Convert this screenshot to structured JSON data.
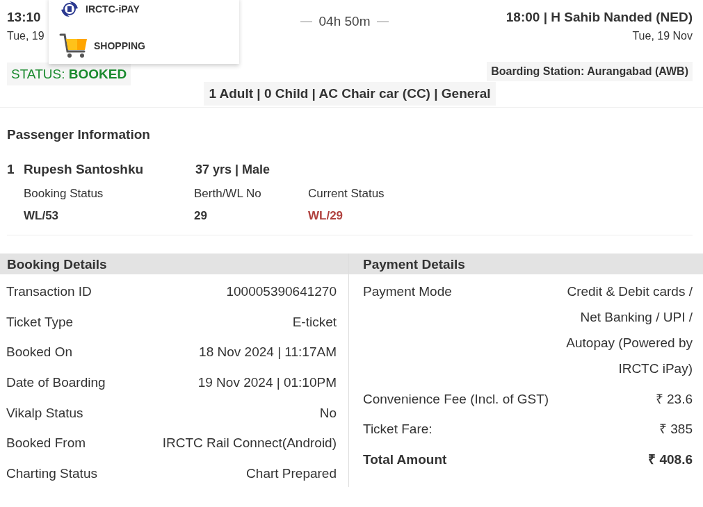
{
  "journey": {
    "departure": {
      "time": "13:10",
      "date": "Tue, 19"
    },
    "duration": "04h 50m",
    "arrival": {
      "time_station": "18:00 | H Sahib Nanded (NED)",
      "date": "Tue, 19 Nov"
    },
    "status": {
      "label": "STATUS:",
      "value": "BOOKED"
    },
    "boarding_station": "Boarding Station: Aurangabad (AWB)",
    "summary": "1 Adult | 0 Child | AC Chair car (CC) | General"
  },
  "menu": [
    {
      "label": "IRCTC-iPAY",
      "kind": "ipay"
    },
    {
      "label": "SHOPPING",
      "kind": "cart"
    }
  ],
  "passenger_information": {
    "title": "Passenger Information",
    "passengers": [
      {
        "number": "1",
        "name": "Rupesh Santoshku",
        "age_gender": "37 yrs | Male",
        "fields": [
          {
            "label": "Booking Status",
            "value": "WL/53",
            "color": "#333333"
          },
          {
            "label": "Berth/WL No",
            "value": "29",
            "color": "#333333"
          },
          {
            "label": "Current Status",
            "value": "WL/29",
            "color": "#b0413e"
          }
        ]
      }
    ]
  },
  "booking_details": {
    "title": "Booking Details",
    "rows": [
      {
        "label": "Transaction ID",
        "value": [
          "100005390641270"
        ],
        "kind": "normal"
      },
      {
        "label": "Ticket Type",
        "value": [
          "E-ticket"
        ],
        "kind": "normal"
      },
      {
        "label": "Booked On",
        "value": [
          "18 Nov 2024 | 11:17AM"
        ],
        "kind": "normal"
      },
      {
        "label": "Date of Boarding",
        "value": [
          "19 Nov 2024 | 01:10PM"
        ],
        "kind": "normal"
      },
      {
        "label": "Vikalp Status",
        "value": [
          "No"
        ],
        "kind": "normal"
      },
      {
        "label": "Booked From",
        "value": [
          "IRCTC Rail Connect(Android)"
        ],
        "kind": "normal"
      },
      {
        "label": "Charting Status",
        "value": [
          "Chart Prepared"
        ],
        "kind": "normal"
      }
    ]
  },
  "payment_details": {
    "title": "Payment Details",
    "rows": [
      {
        "label": "Payment Mode",
        "value": [
          "Credit & Debit cards /",
          "Net Banking / UPI /",
          "Autopay (Powered by",
          "IRCTC iPay)"
        ],
        "kind": "normal"
      },
      {
        "label": "Convenience Fee (Incl. of GST)",
        "value": [
          "₹ 23.6"
        ],
        "kind": "normal"
      },
      {
        "label": "Ticket Fare:",
        "value": [
          "₹ 385"
        ],
        "kind": "normal"
      },
      {
        "label": "Total Amount",
        "value": [
          "₹ 408.6"
        ],
        "kind": "total"
      }
    ]
  }
}
